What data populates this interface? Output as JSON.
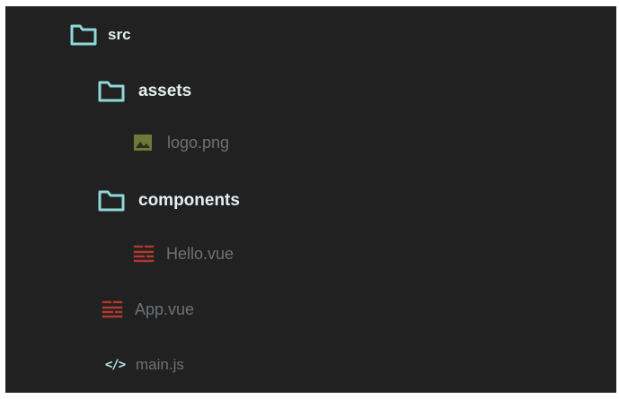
{
  "tree": {
    "src": {
      "label": "src",
      "icon": "folder-icon"
    },
    "assets": {
      "label": "assets",
      "icon": "folder-icon"
    },
    "logo": {
      "label": "logo.png",
      "icon": "image-file-icon"
    },
    "components": {
      "label": "components",
      "icon": "folder-icon"
    },
    "hello": {
      "label": "Hello.vue",
      "icon": "vue-file-icon"
    },
    "app": {
      "label": "App.vue",
      "icon": "vue-file-icon"
    },
    "main": {
      "label": "main.js",
      "icon": "js-file-icon",
      "glyph": "</>"
    }
  },
  "colors": {
    "panel_bg": "#212121",
    "folder_icon": "#8ed8da",
    "folder_label": "#e8eef0",
    "file_label": "#6e7176",
    "image_icon": "#6b7a3a",
    "vue_icon": "#b03a2e",
    "js_icon": "#b8e6e8"
  }
}
